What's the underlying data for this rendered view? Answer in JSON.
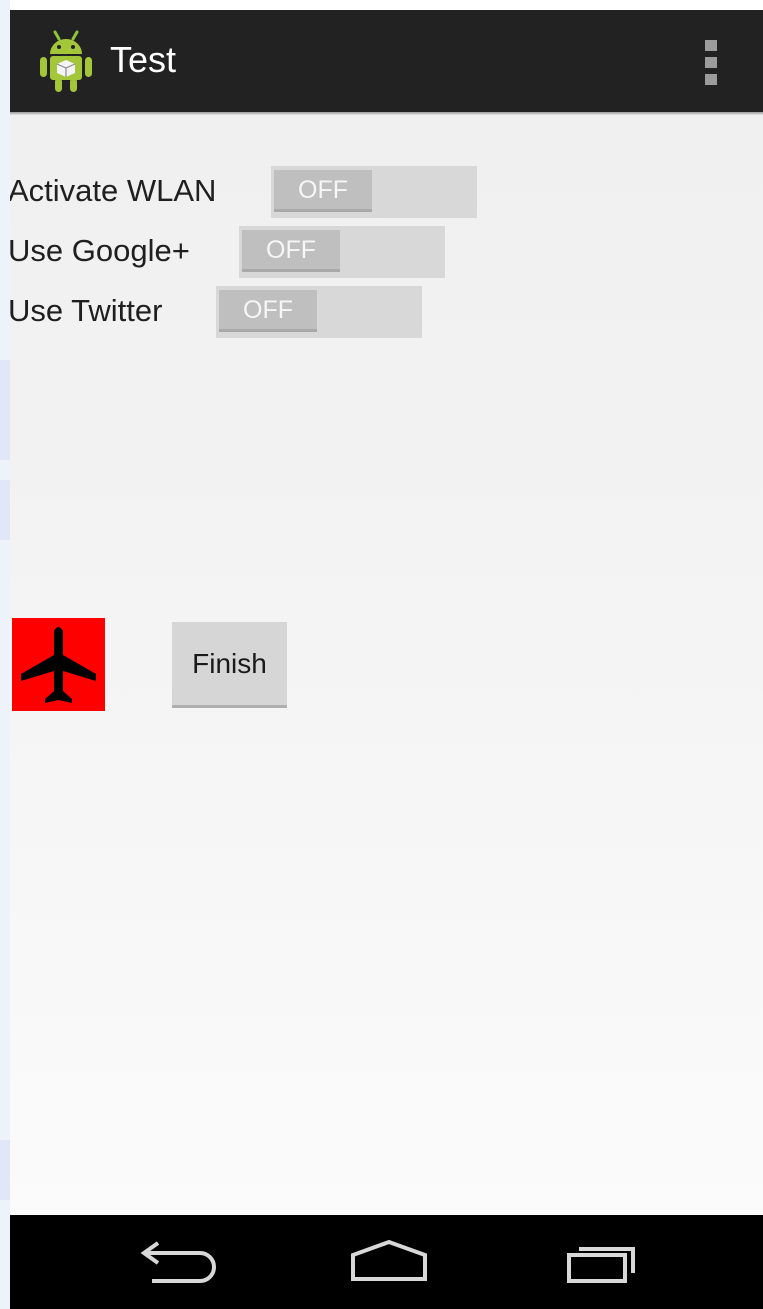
{
  "action_bar": {
    "title": "Test",
    "app_icon": "android-robot-icon",
    "overflow_icon": "overflow-menu-icon"
  },
  "settings": [
    {
      "label": "Activate WLAN",
      "state": "OFF"
    },
    {
      "label": "Use Google+",
      "state": "OFF"
    },
    {
      "label": "Use Twitter",
      "state": "OFF"
    }
  ],
  "airplane_mode": {
    "icon": "airplane-icon",
    "color": "#ff0000"
  },
  "finish_button": {
    "label": "Finish"
  },
  "nav_bar": {
    "back_icon": "back-icon",
    "home_icon": "home-icon",
    "recents_icon": "recent-apps-icon"
  },
  "colors": {
    "action_bar": "#222222",
    "background": "#f2f2f2",
    "switch_track": "#d8d8d8",
    "switch_thumb": "#bfbfbf"
  }
}
